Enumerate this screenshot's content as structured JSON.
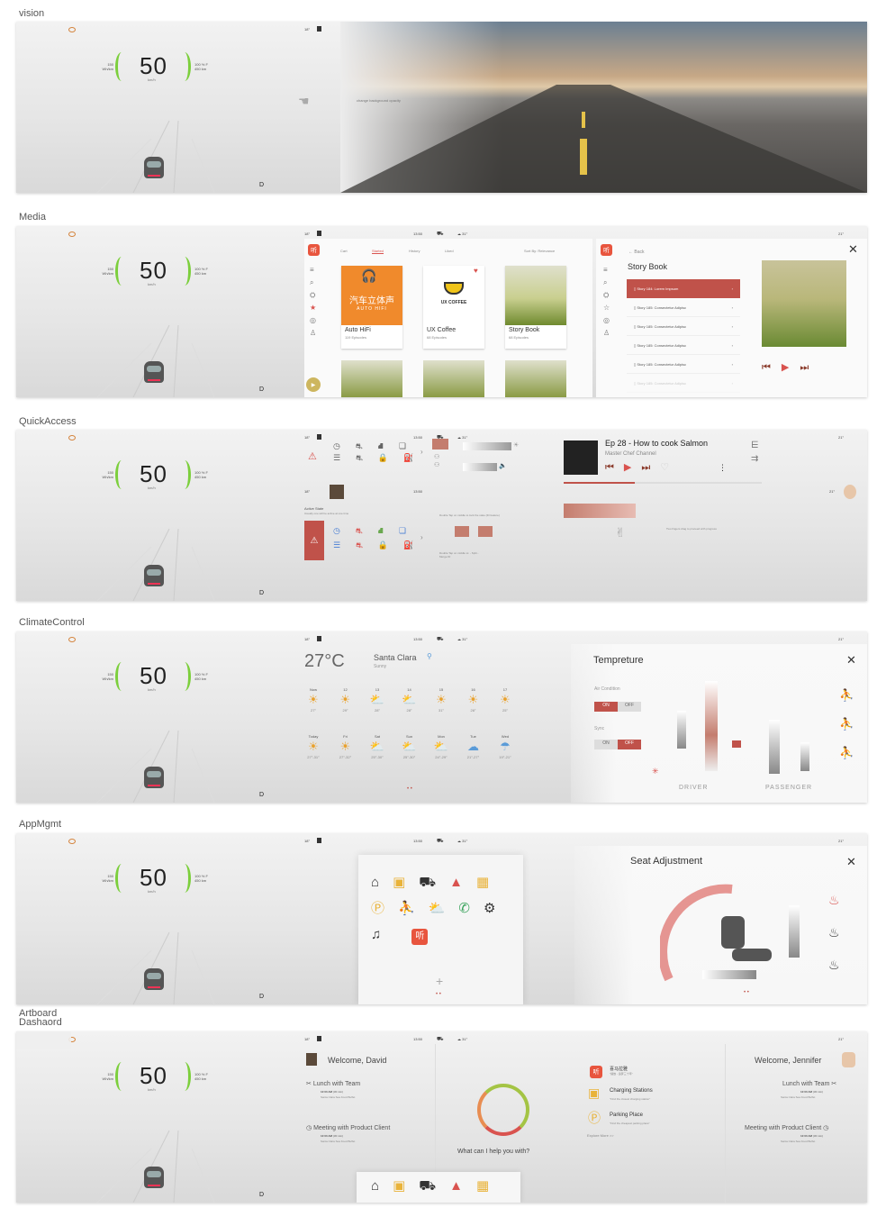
{
  "artboards": {
    "vision": "vision",
    "media": "Media",
    "quick": "QuickAccess",
    "climate": "ClimateControl",
    "app": "AppMgmt",
    "dash_l1": "Artboard",
    "dash_l2": "Dashaord"
  },
  "cluster": {
    "speed": "50",
    "unit": "km/h",
    "left_top": "150",
    "left_bot": "Wh/km",
    "right_top": "100 % F",
    "right_bot": "450 km",
    "gear": "D"
  },
  "status": {
    "temp_in": "18°",
    "time": "13:50",
    "temp_out": "31°",
    "temp_right": "21°"
  },
  "vision": {
    "hint": "change background opacity"
  },
  "media": {
    "tabs": [
      "Cart",
      "Started",
      "History",
      "Liked"
    ],
    "sort": "Sort By: Relevance",
    "cards": [
      {
        "title": "Auto HiFi",
        "sub": "119 Episodes",
        "art": "汽车立体声",
        "art2": "AUTO HIFI"
      },
      {
        "title": "UX Coffee",
        "sub": "68 Episodes",
        "art": "UX COFFEE"
      },
      {
        "title": "Story Book",
        "sub": "68 Episodes"
      }
    ],
    "back": "Back",
    "detail_title": "Story Book",
    "tracks": [
      "Story 184: Lorem Impsum",
      "Story 185: Consectetur Adipisc",
      "Story 185: Consectetur Adipisc",
      "Story 185: Consectetur Adipisc",
      "Story 185: Consectetur Adipisc",
      "Story 185: Consectetur Adipisc"
    ]
  },
  "quick": {
    "np_title": "Ep 28 - How to cook Salmon",
    "np_sub": "Master Chef Channel",
    "active_state": "Active State",
    "active_sub": "Usually one will be active at one time",
    "dbl1": "Double Tap on middle to lock the state (ID feature)",
    "dbl2": "Double Tap on middle to: - Split - Merge ID",
    "two_fingers": "Two fingers drag to proceed with progress"
  },
  "climate": {
    "temp": "27°C",
    "city": "Santa Clara",
    "cond": "Sunny",
    "hours": [
      "Now",
      "12",
      "13",
      "14",
      "15",
      "16",
      "17"
    ],
    "hour_temps": [
      "27°",
      "29°",
      "28°",
      "28°",
      "31°",
      "26°",
      "25°"
    ],
    "days": [
      "Today",
      "Fri",
      "Sat",
      "Sun",
      "Mon",
      "Tue",
      "Wed"
    ],
    "day_temps": [
      "27°-31°",
      "27°-32°",
      "25°-30°",
      "25°-30°",
      "24°-29°",
      "21°-27°",
      "19°-21°"
    ],
    "panel_title": "Tempreture",
    "air": "Air Condition",
    "sync": "Sync",
    "on": "ON",
    "off": "OFF",
    "driver": "DRIVER",
    "passenger": "PASSENGER"
  },
  "app": {
    "seat_title": "Seat Adjustment",
    "plus": "+"
  },
  "dash": {
    "welcome_l": "Welcome, David",
    "welcome_r": "Welcome, Jennifer",
    "ev1": "Lunch with Team",
    "ev1_time": "12:00 AM",
    "ev1_dur": "(30 min)",
    "ev1_loc": "Santa Clara Sea Food Buffet",
    "ev2": "Meeting with Product Client",
    "ev2_time": "12:00 AM",
    "ev2_dur": "(30 min)",
    "ev2_loc": "Santa Clara Sea Food Buffet",
    "help": "What can I help you with?",
    "sug1_title": "喜马拉雅",
    "sug1_sub": "\"播放 - 追梦三十年\"",
    "sug2_title": "Charging Stations",
    "sug2_sub": "\"Find the closest charging station\"",
    "sug3_title": "Parking Place",
    "sug3_sub": "\"Find the cheapest parking place\"",
    "explore": "Explore More >>"
  },
  "colors": {
    "accent": "#d9534f",
    "muted_accent": "#c47d6e",
    "green": "#7ccf3c"
  }
}
